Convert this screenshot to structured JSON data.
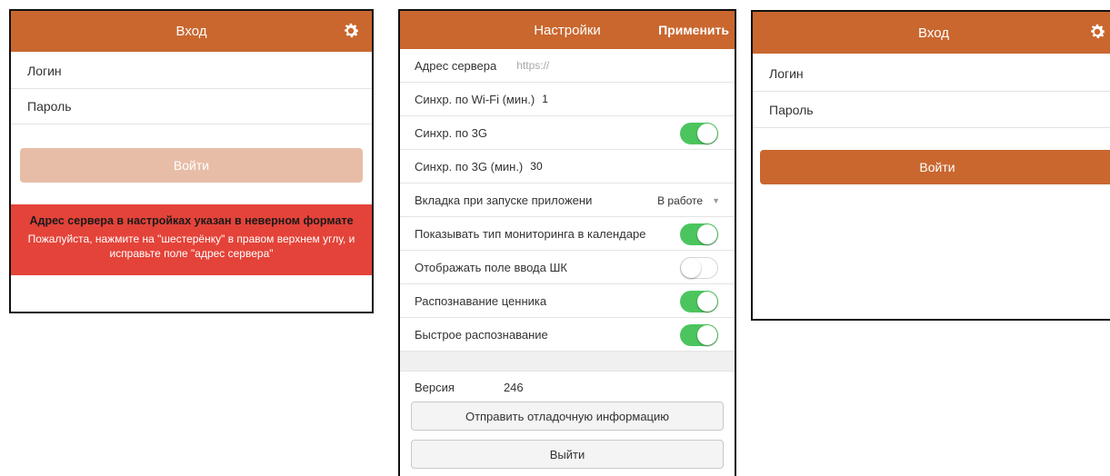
{
  "login_error_screen": {
    "header_title": "Вход",
    "login_placeholder": "Логин",
    "password_placeholder": "Пароль",
    "login_button": "Войти",
    "error_title": "Адрес сервера в настройках указан в неверном формате",
    "error_text": "Пожалуйста, нажмите на \"шестерёнку\" в правом верхнем углу, и исправьте поле \"адрес сервера\""
  },
  "settings_screen": {
    "header_title": "Настройки",
    "apply_button": "Применить",
    "server_address_label": "Адрес сервера",
    "server_address_placeholder": "https://",
    "wifi_sync_label": "Синхр. по Wi-Fi (мин.)",
    "wifi_sync_value": "1",
    "sync_3g_label": "Синхр. по 3G",
    "sync_3g_on": true,
    "sync_3g_interval_label": "Синхр. по 3G (мин.)",
    "sync_3g_interval_value": "30",
    "startup_tab_label": "Вкладка при запуске приложени",
    "startup_tab_value": "В работе",
    "show_monitoring_type_label": "Показывать тип мониторинга в календаре",
    "show_monitoring_type_on": true,
    "show_barcode_field_label": "Отображать поле ввода ШК",
    "show_barcode_field_on": false,
    "price_tag_recognition_label": "Распознавание ценника",
    "price_tag_recognition_on": true,
    "fast_recognition_label": "Быстрое распознавание",
    "fast_recognition_on": true,
    "version_label": "Версия",
    "version_value": "246",
    "send_debug_button": "Отправить отладочную информацию",
    "logout_button": "Выйти"
  },
  "login_screen": {
    "header_title": "Вход",
    "login_placeholder": "Логин",
    "password_placeholder": "Пароль",
    "login_button": "Войти"
  },
  "colors": {
    "header": "#c9672f",
    "button_active": "#c9672f",
    "button_disabled": "#e8bda8",
    "error": "#e44339",
    "toggle_on": "#4cc55e"
  },
  "icons": {
    "settings": "gear-icon",
    "dropdown": "caret-down-icon"
  }
}
